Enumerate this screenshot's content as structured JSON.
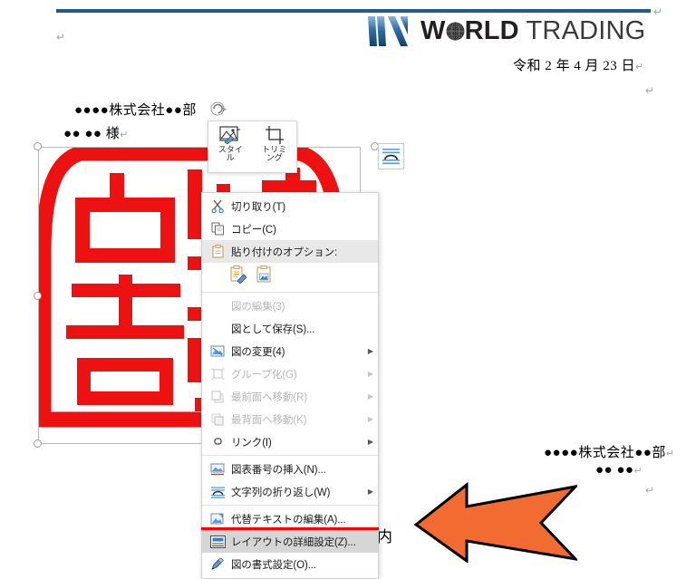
{
  "document": {
    "header_rule_color": "#1a5a8a",
    "logo": {
      "mark_name": "world-trading-logo-mark",
      "word1": "W",
      "word1_tail": "RLD",
      "word2": "TRADING",
      "globe_icon": "globe-icon"
    },
    "date": "令和 2 年 4 月 23 日",
    "address_line1": "●●●●株式会社●●部",
    "address_line2": "●● ●● 様",
    "sender_line1": "●●●●株式会社●●部",
    "sender_line2": "●● ●●",
    "subject": "ご案内",
    "pilcrow": "↵"
  },
  "image_object": {
    "name": "hanko-seal-image",
    "stamp_color": "#ee1111",
    "rotate_handle": "rotate-handle",
    "layout_options_icon": "text-wrapping-icon"
  },
  "mini_toolbar": {
    "items": [
      {
        "label": "スタイル",
        "icon": "picture-style-icon"
      },
      {
        "label": "トリミング",
        "icon": "crop-icon"
      }
    ]
  },
  "context_menu": {
    "items": [
      {
        "label": "切り取り(T)",
        "icon": "scissors-icon",
        "accel": "T",
        "disabled": false,
        "submenu": false,
        "highlighted": false
      },
      {
        "label": "コピー(C)",
        "icon": "copy-icon",
        "accel": "C",
        "disabled": false,
        "submenu": false,
        "highlighted": false
      },
      {
        "label": "貼り付けのオプション:",
        "icon": "paste-icon",
        "accel": "",
        "disabled": false,
        "submenu": false,
        "highlighted": false,
        "section_head": true
      },
      {
        "label": "図の編集(3)",
        "icon": "none",
        "accel": "3",
        "disabled": true,
        "submenu": false,
        "highlighted": false
      },
      {
        "label": "図として保存(S)...",
        "icon": "none",
        "accel": "S",
        "disabled": false,
        "submenu": false,
        "highlighted": false
      },
      {
        "label": "図の変更(4)",
        "icon": "change-picture-icon",
        "accel": "4",
        "disabled": false,
        "submenu": true,
        "highlighted": false
      },
      {
        "label": "グループ化(G)",
        "icon": "group-icon",
        "accel": "G",
        "disabled": true,
        "submenu": true,
        "highlighted": false
      },
      {
        "label": "最前面へ移動(R)",
        "icon": "bring-front-icon",
        "accel": "R",
        "disabled": true,
        "submenu": true,
        "highlighted": false
      },
      {
        "label": "最背面へ移動(K)",
        "icon": "send-back-icon",
        "accel": "K",
        "disabled": true,
        "submenu": true,
        "highlighted": false
      },
      {
        "label": "リンク(I)",
        "icon": "link-icon",
        "accel": "I",
        "disabled": false,
        "submenu": true,
        "highlighted": false
      },
      {
        "label": "図表番号の挿入(N)...",
        "icon": "insert-caption-icon",
        "accel": "N",
        "disabled": false,
        "submenu": false,
        "highlighted": false
      },
      {
        "label": "文字列の折り返し(W)",
        "icon": "wrap-text-icon",
        "accel": "W",
        "disabled": false,
        "submenu": true,
        "highlighted": false
      },
      {
        "label": "代替テキストの編集(A)...",
        "icon": "alt-text-icon",
        "accel": "A",
        "disabled": false,
        "submenu": false,
        "highlighted": false
      },
      {
        "label": "レイアウトの詳細設定(Z)...",
        "icon": "layout-options-icon",
        "accel": "Z",
        "disabled": false,
        "submenu": false,
        "highlighted": true
      },
      {
        "label": "図の書式設定(O)...",
        "icon": "format-picture-icon",
        "accel": "O",
        "disabled": false,
        "submenu": false,
        "highlighted": false
      }
    ],
    "paste_options": [
      {
        "icon": "paste-keep-formatting-icon"
      },
      {
        "icon": "paste-picture-icon"
      }
    ],
    "highlight_underline_color": "#ff0000"
  },
  "annotation": {
    "arrow_icon": "left-arrow-callout",
    "arrow_fill": "#f26b31",
    "arrow_stroke": "#000000"
  }
}
